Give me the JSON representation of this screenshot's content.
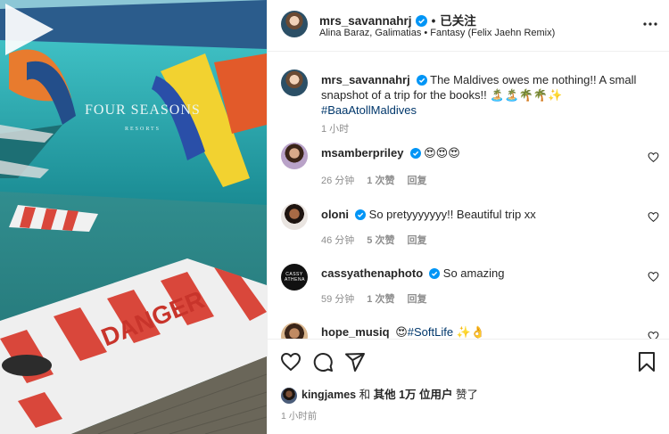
{
  "media": {
    "scene_text": {
      "brand": "FOUR SEASONS",
      "brand_sub": "RESORTS",
      "dock": "DANGER"
    }
  },
  "header": {
    "username": "mrs_savannahrj",
    "follow_label": "已关注",
    "song": "Alina Baraz, Galimatias • Fantasy (Felix Jaehn Remix)"
  },
  "caption": {
    "username": "mrs_savannahrj",
    "text": "The Maldives owes me nothing!! A small snapshot of a trip for the books!! 🏝️🏝️🌴🌴✨ ",
    "hashtag": "#BaaAtollMaldives",
    "time": "1 小时"
  },
  "comments": [
    {
      "username": "msamberpriley",
      "text": "😍😍😍",
      "time": "26 分钟",
      "likes": "1 次赞",
      "reply": "回复"
    },
    {
      "username": "oloni",
      "text": "So pretyyyyyyy!! Beautiful trip xx",
      "time": "46 分钟",
      "likes": "5 次赞",
      "reply": "回复"
    },
    {
      "username": "cassyathenaphoto",
      "text": "So amazing",
      "time": "59 分钟",
      "likes": "1 次赞",
      "reply": "回复",
      "avatar_text": "CASSY ATHENA"
    },
    {
      "username": "hope_musiq",
      "text": "😍",
      "hashtag": "#SoftLife",
      "emoji": " ✨👌"
    }
  ],
  "likes": {
    "user": "kingjames",
    "connector": " 和 ",
    "others": "其他 1万 位用户",
    "suffix": " 赞了"
  },
  "post_time": "1 小时前",
  "colors": {
    "verified": "#0095f6",
    "link": "#00376b",
    "meta": "#8e8e8e",
    "water": "#2e8a8a"
  }
}
